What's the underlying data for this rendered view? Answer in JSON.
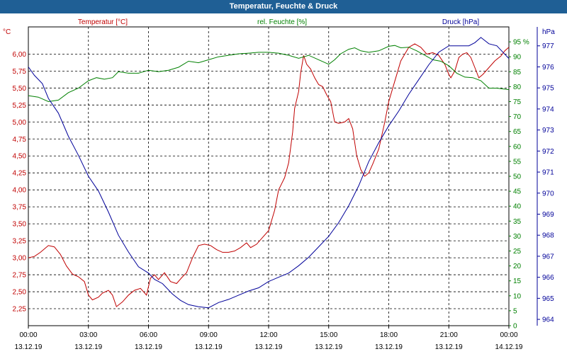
{
  "window": {
    "title": "Temperatur, Feuchte & Druck"
  },
  "chart_data": {
    "type": "line",
    "title": "Temperatur, Feuchte & Druck",
    "grid": true,
    "colors": {
      "temperature": "#c00000",
      "humidity": "#008000",
      "pressure": "#000099",
      "titlebar": "#1f5f95"
    },
    "axes": {
      "left": {
        "label": "Temperatur [°C]",
        "unit": "°C",
        "ylim": [
          2.0,
          6.4
        ],
        "ticks": [
          "6,00",
          "5,75",
          "5,50",
          "5,25",
          "5,00",
          "4,75",
          "4,50",
          "4,25",
          "4,00",
          "3,75",
          "3,50",
          "3,25",
          "3,00",
          "2,75",
          "2,50",
          "2,25"
        ]
      },
      "mid": {
        "label": "rel. Feuchte [%]",
        "unit": "%",
        "ylim": [
          0,
          100
        ],
        "ticks": [
          "95",
          "90",
          "85",
          "80",
          "75",
          "70",
          "65",
          "60",
          "55",
          "50",
          "45",
          "40",
          "35",
          "30",
          "25",
          "20",
          "15",
          "10",
          "5",
          "0"
        ]
      },
      "right": {
        "label": "Druck [hPa]",
        "unit": "hPa",
        "ylim": [
          963.7,
          977.9
        ],
        "ticks": [
          "977",
          "976",
          "975",
          "974",
          "973",
          "972",
          "971",
          "970",
          "969",
          "968",
          "967",
          "966",
          "965",
          "964"
        ]
      }
    },
    "x_ticks": [
      {
        "time": "00:00",
        "date": "13.12.19"
      },
      {
        "time": "03:00",
        "date": "13.12.19"
      },
      {
        "time": "06:00",
        "date": "13.12.19"
      },
      {
        "time": "09:00",
        "date": "13.12.19"
      },
      {
        "time": "12:00",
        "date": "13.12.19"
      },
      {
        "time": "15:00",
        "date": "13.12.19"
      },
      {
        "time": "18:00",
        "date": "13.12.19"
      },
      {
        "time": "21:00",
        "date": "13.12.19"
      },
      {
        "time": "00:00",
        "date": "14.12.19"
      }
    ],
    "x_range_hours": [
      0,
      24
    ],
    "series": [
      {
        "name": "Temperatur [°C]",
        "axis": "left",
        "color": "#c00000",
        "points": [
          [
            0,
            3.0
          ],
          [
            0.3,
            3.02
          ],
          [
            0.6,
            3.08
          ],
          [
            1.0,
            3.18
          ],
          [
            1.3,
            3.16
          ],
          [
            1.6,
            3.05
          ],
          [
            1.9,
            2.88
          ],
          [
            2.2,
            2.76
          ],
          [
            2.5,
            2.72
          ],
          [
            2.8,
            2.65
          ],
          [
            3.0,
            2.45
          ],
          [
            3.2,
            2.38
          ],
          [
            3.5,
            2.42
          ],
          [
            3.7,
            2.48
          ],
          [
            4.0,
            2.52
          ],
          [
            4.2,
            2.45
          ],
          [
            4.4,
            2.28
          ],
          [
            4.7,
            2.35
          ],
          [
            5.0,
            2.45
          ],
          [
            5.3,
            2.52
          ],
          [
            5.6,
            2.55
          ],
          [
            5.9,
            2.45
          ],
          [
            6.1,
            2.7
          ],
          [
            6.3,
            2.75
          ],
          [
            6.5,
            2.68
          ],
          [
            6.8,
            2.78
          ],
          [
            7.1,
            2.65
          ],
          [
            7.4,
            2.62
          ],
          [
            7.7,
            2.72
          ],
          [
            7.9,
            2.78
          ],
          [
            8.2,
            3.0
          ],
          [
            8.5,
            3.18
          ],
          [
            8.8,
            3.2
          ],
          [
            9.1,
            3.18
          ],
          [
            9.4,
            3.12
          ],
          [
            9.7,
            3.08
          ],
          [
            10.0,
            3.08
          ],
          [
            10.3,
            3.1
          ],
          [
            10.6,
            3.15
          ],
          [
            10.9,
            3.22
          ],
          [
            11.1,
            3.15
          ],
          [
            11.4,
            3.2
          ],
          [
            11.7,
            3.3
          ],
          [
            12.0,
            3.4
          ],
          [
            12.3,
            3.7
          ],
          [
            12.5,
            4.0
          ],
          [
            12.8,
            4.18
          ],
          [
            13.0,
            4.4
          ],
          [
            13.2,
            4.85
          ],
          [
            13.3,
            5.2
          ],
          [
            13.5,
            5.45
          ],
          [
            13.6,
            5.72
          ],
          [
            13.75,
            5.98
          ],
          [
            13.9,
            5.85
          ],
          [
            14.1,
            5.78
          ],
          [
            14.3,
            5.65
          ],
          [
            14.5,
            5.55
          ],
          [
            14.7,
            5.52
          ],
          [
            14.9,
            5.4
          ],
          [
            15.1,
            5.3
          ],
          [
            15.3,
            5.0
          ],
          [
            15.5,
            4.98
          ],
          [
            15.8,
            5.0
          ],
          [
            16.0,
            5.05
          ],
          [
            16.2,
            4.9
          ],
          [
            16.4,
            4.5
          ],
          [
            16.6,
            4.3
          ],
          [
            16.8,
            4.2
          ],
          [
            17.0,
            4.25
          ],
          [
            17.2,
            4.38
          ],
          [
            17.5,
            4.6
          ],
          [
            17.8,
            5.0
          ],
          [
            18.0,
            5.3
          ],
          [
            18.3,
            5.6
          ],
          [
            18.6,
            5.9
          ],
          [
            19.0,
            6.1
          ],
          [
            19.3,
            6.15
          ],
          [
            19.6,
            6.1
          ],
          [
            19.9,
            6.0
          ],
          [
            20.2,
            6.02
          ],
          [
            20.5,
            5.98
          ],
          [
            20.8,
            5.85
          ],
          [
            21.0,
            5.7
          ],
          [
            21.1,
            5.65
          ],
          [
            21.3,
            5.75
          ],
          [
            21.5,
            5.95
          ],
          [
            21.7,
            6.0
          ],
          [
            21.9,
            6.02
          ],
          [
            22.1,
            5.95
          ],
          [
            22.3,
            5.8
          ],
          [
            22.5,
            5.65
          ],
          [
            22.7,
            5.7
          ],
          [
            23.0,
            5.8
          ],
          [
            23.3,
            5.9
          ],
          [
            23.6,
            5.97
          ],
          [
            23.8,
            6.05
          ],
          [
            24.0,
            6.1
          ]
        ]
      },
      {
        "name": "rel. Feuchte [%]",
        "axis": "mid",
        "color": "#008000",
        "points": [
          [
            0,
            77
          ],
          [
            0.5,
            76.5
          ],
          [
            1.0,
            75
          ],
          [
            1.5,
            75.5
          ],
          [
            2.0,
            78
          ],
          [
            2.5,
            79.5
          ],
          [
            3.0,
            82
          ],
          [
            3.4,
            83
          ],
          [
            3.8,
            82.5
          ],
          [
            4.2,
            83
          ],
          [
            4.5,
            85
          ],
          [
            5.0,
            84.5
          ],
          [
            5.5,
            84.5
          ],
          [
            6.0,
            85.5
          ],
          [
            6.5,
            85
          ],
          [
            7.0,
            85.5
          ],
          [
            7.5,
            86.5
          ],
          [
            8.0,
            88.5
          ],
          [
            8.5,
            88
          ],
          [
            9.0,
            89
          ],
          [
            9.5,
            90
          ],
          [
            10.0,
            90.5
          ],
          [
            10.5,
            91
          ],
          [
            11.0,
            91.2
          ],
          [
            11.5,
            91.5
          ],
          [
            12.0,
            91.5
          ],
          [
            12.5,
            91.2
          ],
          [
            13.0,
            90.5
          ],
          [
            13.5,
            89.5
          ],
          [
            14.0,
            90.5
          ],
          [
            14.5,
            89
          ],
          [
            15.0,
            87.5
          ],
          [
            15.3,
            89
          ],
          [
            15.6,
            91
          ],
          [
            16.0,
            92.5
          ],
          [
            16.3,
            93
          ],
          [
            16.6,
            92
          ],
          [
            17.0,
            91.5
          ],
          [
            17.5,
            92
          ],
          [
            18.0,
            93.5
          ],
          [
            18.3,
            93.8
          ],
          [
            18.6,
            93
          ],
          [
            19.0,
            93.2
          ],
          [
            19.4,
            92
          ],
          [
            19.8,
            90.5
          ],
          [
            20.2,
            89
          ],
          [
            20.6,
            88.5
          ],
          [
            21.0,
            87
          ],
          [
            21.4,
            84.5
          ],
          [
            21.8,
            83.2
          ],
          [
            22.2,
            83
          ],
          [
            22.6,
            82
          ],
          [
            23.0,
            79.5
          ],
          [
            23.4,
            79.5
          ],
          [
            24.0,
            79
          ]
        ]
      },
      {
        "name": "Druck [hPa]",
        "axis": "right",
        "color": "#000099",
        "points": [
          [
            0,
            976.0
          ],
          [
            0.3,
            975.6
          ],
          [
            0.7,
            975.2
          ],
          [
            1.0,
            974.5
          ],
          [
            1.5,
            973.8
          ],
          [
            2.0,
            972.7
          ],
          [
            2.5,
            971.8
          ],
          [
            3.0,
            970.8
          ],
          [
            3.5,
            970.1
          ],
          [
            4.0,
            969.1
          ],
          [
            4.5,
            968.0
          ],
          [
            5.0,
            967.2
          ],
          [
            5.5,
            966.5
          ],
          [
            6.0,
            966.2
          ],
          [
            6.3,
            965.9
          ],
          [
            6.7,
            965.7
          ],
          [
            7.2,
            965.2
          ],
          [
            7.6,
            964.9
          ],
          [
            8.0,
            964.7
          ],
          [
            8.5,
            964.6
          ],
          [
            9.0,
            964.55
          ],
          [
            9.5,
            964.8
          ],
          [
            10.0,
            964.95
          ],
          [
            10.5,
            965.15
          ],
          [
            11.0,
            965.35
          ],
          [
            11.5,
            965.5
          ],
          [
            12.0,
            965.8
          ],
          [
            12.5,
            966.0
          ],
          [
            13.0,
            966.2
          ],
          [
            13.5,
            966.55
          ],
          [
            14.0,
            966.95
          ],
          [
            14.5,
            967.45
          ],
          [
            15.0,
            967.95
          ],
          [
            15.5,
            968.6
          ],
          [
            16.0,
            969.4
          ],
          [
            16.5,
            970.35
          ],
          [
            17.0,
            971.5
          ],
          [
            17.5,
            972.4
          ],
          [
            18.0,
            973.2
          ],
          [
            18.5,
            973.9
          ],
          [
            19.0,
            974.7
          ],
          [
            19.5,
            975.4
          ],
          [
            20.0,
            976.1
          ],
          [
            20.5,
            976.7
          ],
          [
            21.0,
            977.0
          ],
          [
            21.5,
            977.0
          ],
          [
            22.0,
            977.0
          ],
          [
            22.3,
            977.15
          ],
          [
            22.6,
            977.4
          ],
          [
            23.0,
            977.1
          ],
          [
            23.4,
            977.0
          ],
          [
            23.7,
            976.7
          ],
          [
            24.0,
            976.4
          ]
        ]
      }
    ]
  }
}
